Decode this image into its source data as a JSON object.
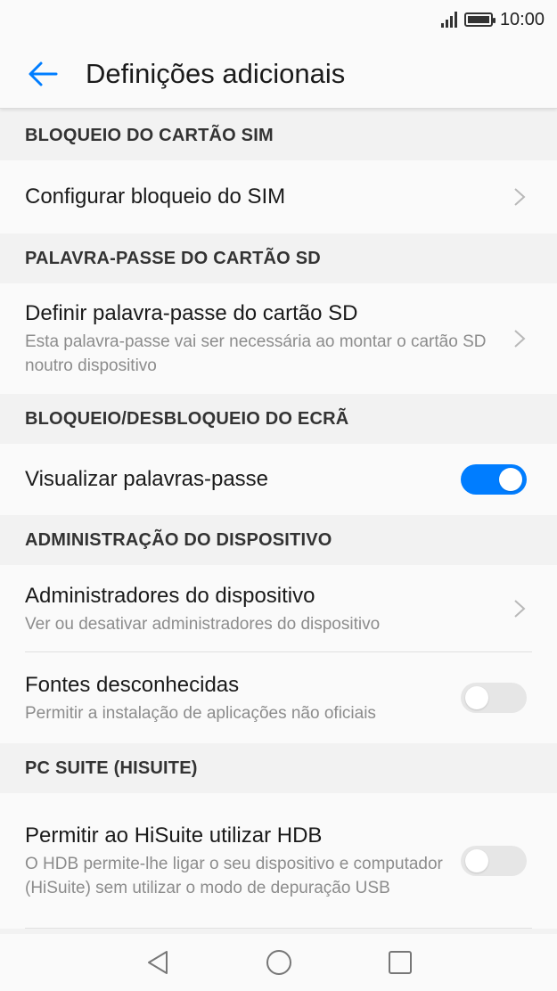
{
  "status_bar": {
    "time": "10:00",
    "icons": [
      "signal-icon",
      "battery-icon"
    ]
  },
  "app_bar": {
    "title": "Definições adicionais",
    "back_icon": "arrow-left-icon"
  },
  "sections": [
    {
      "header": "BLOQUEIO DO CARTÃO SIM",
      "items": [
        {
          "title": "Configurar bloqueio do SIM",
          "subtitle": "",
          "control": "chevron"
        }
      ]
    },
    {
      "header": "PALAVRA-PASSE DO CARTÃO SD",
      "items": [
        {
          "title": "Definir palavra-passe do cartão SD",
          "subtitle": "Esta palavra-passe vai ser necessária ao montar o cartão SD noutro dispositivo",
          "control": "chevron"
        }
      ]
    },
    {
      "header": "BLOQUEIO/DESBLOQUEIO DO ECRÃ",
      "items": [
        {
          "title": "Visualizar palavras-passe",
          "subtitle": "",
          "control": "toggle",
          "toggle_on": true
        }
      ]
    },
    {
      "header": "ADMINISTRAÇÃO DO DISPOSITIVO",
      "items": [
        {
          "title": "Administradores do dispositivo",
          "subtitle": "Ver ou desativar administradores do dispositivo",
          "control": "chevron"
        },
        {
          "title": "Fontes desconhecidas",
          "subtitle": "Permitir a instalação de aplicações não oficiais",
          "control": "toggle",
          "toggle_on": false
        }
      ]
    },
    {
      "header": "PC SUITE (HISUITE)",
      "items": [
        {
          "title": "Permitir ao HiSuite utilizar HDB",
          "subtitle": "O HDB permite-lhe ligar o seu dispositivo e computador (HiSuite) sem utilizar o modo de depuração USB",
          "control": "toggle",
          "toggle_on": false
        }
      ]
    }
  ],
  "colors": {
    "accent": "#007dff",
    "toggle_off": "#e6e6e6",
    "background": "#f2f2f2",
    "surface": "#fafafa"
  },
  "nav_bar": {
    "icons": [
      "back-triangle-icon",
      "home-circle-icon",
      "recents-square-icon"
    ]
  }
}
